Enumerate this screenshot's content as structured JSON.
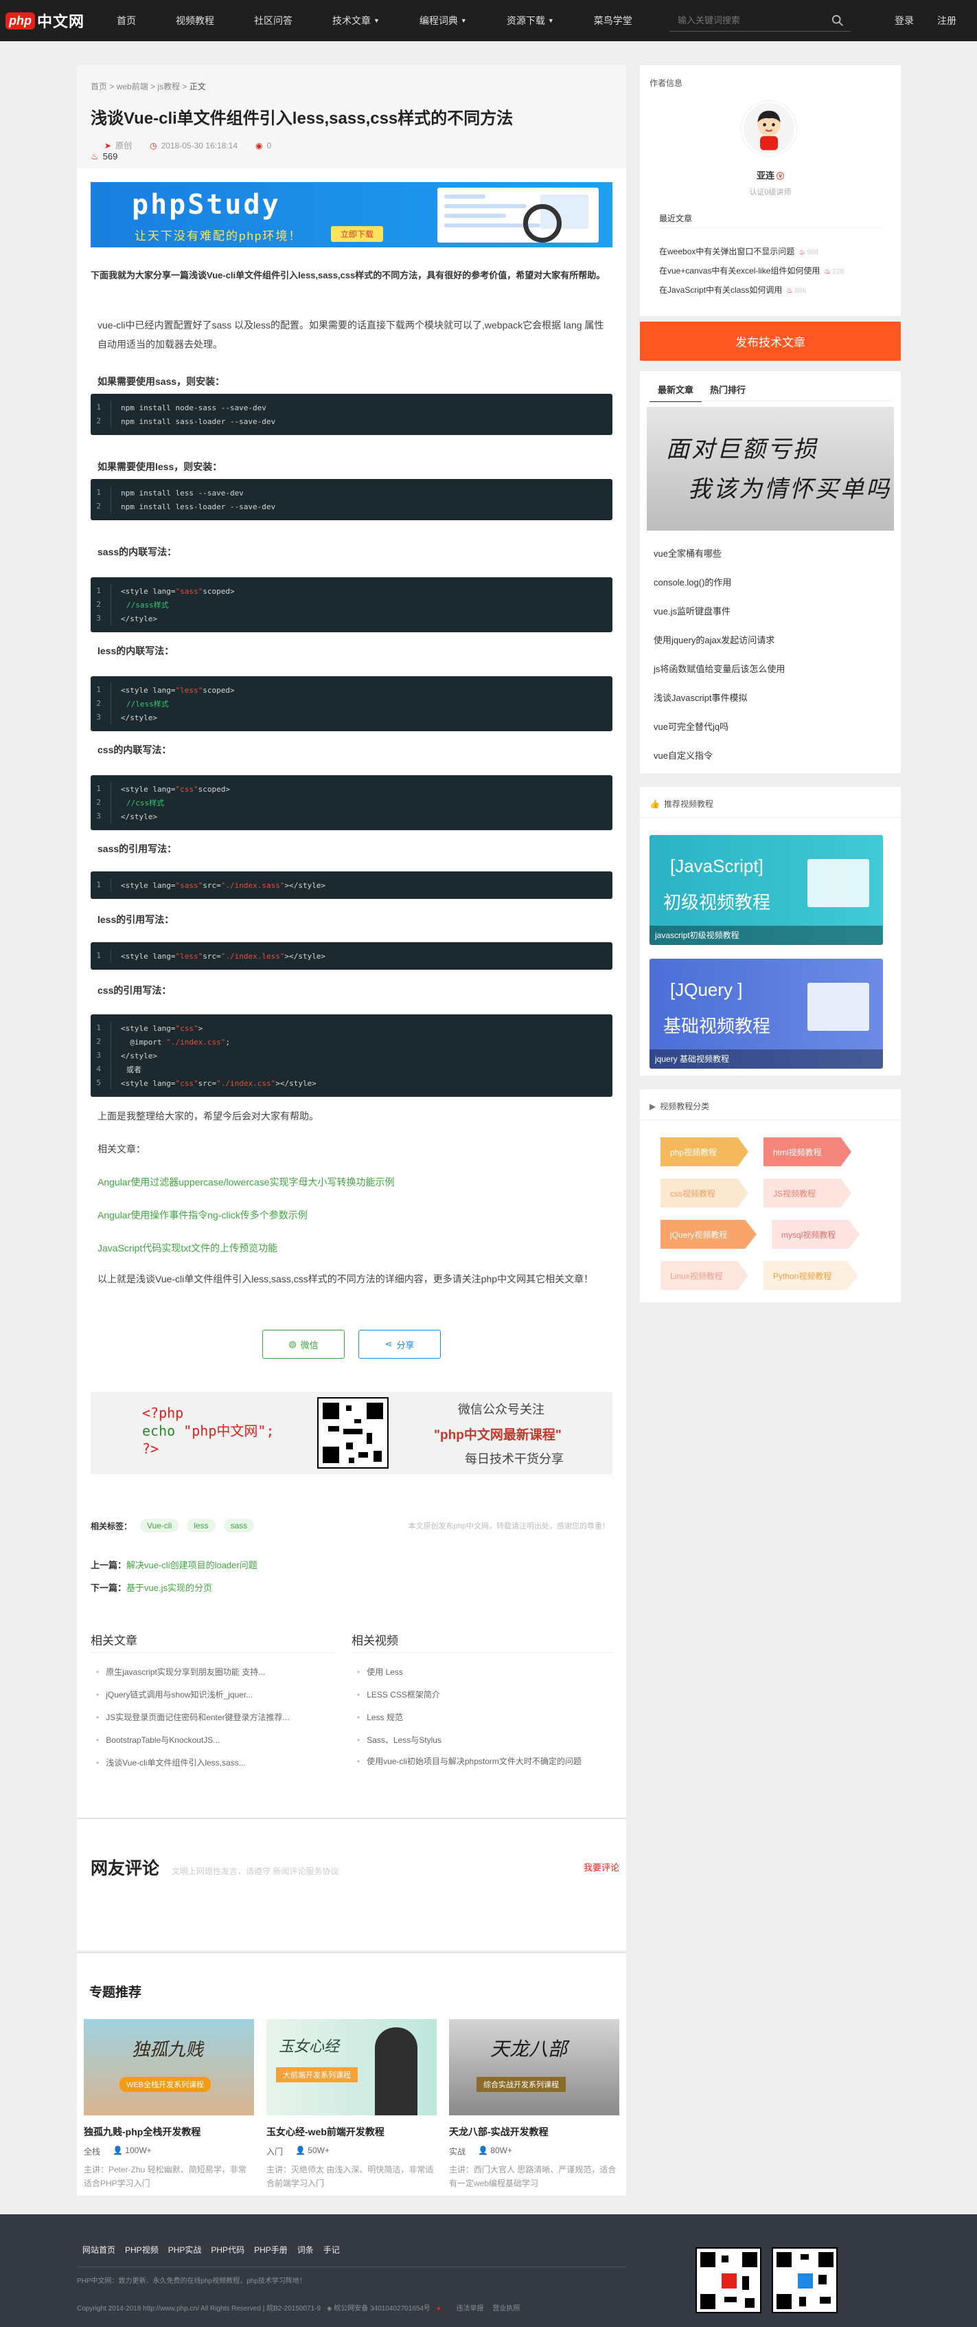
{
  "nav": {
    "logo_php": "php",
    "logo_cn": "中文网",
    "items": [
      "首页",
      "视频教程",
      "社区问答",
      "技术文章",
      "编程词典",
      "资源下载",
      "菜鸟学堂"
    ],
    "search_placeholder": "输入关键词搜索",
    "login": "登录",
    "register": "注册"
  },
  "article": {
    "breadcrumb": [
      "首页",
      "web前端",
      "js教程",
      "正文"
    ],
    "title": "浅谈Vue-cli单文件组件引入less,sass,css样式的不同方法",
    "author": "原创",
    "date": "2018-05-30 16:18:14",
    "views": "0",
    "favorites": "569",
    "banner_title": "phpStudy",
    "banner_slogan": "让天下没有难配的php环境！",
    "banner_button": "立即下载",
    "intro": "下面我就为大家分享一篇浅谈Vue-cli单文件组件引入less,sass,css样式的不同方法，具有很好的参考价值，希望对大家有所帮助。",
    "p1": "vue-cli中已经内置配置好了sass 以及less的配置。如果需要的话直接下载两个模块就可以了,webpack它会根据 lang 属性自动用适当的加载器去处理。",
    "h_sass": "如果需要使用sass，则安装：",
    "code_sass": [
      "npm install node-sass --save-dev",
      "npm install sass-loader --save-dev"
    ],
    "h_less": "如果需要使用less，则安装：",
    "code_less": [
      "npm install less --save-dev",
      "npm install less-loader --save-dev"
    ],
    "h_sass_inline": "sass的内联写法：",
    "code_sass_inline": {
      "l1a": "<style lang=",
      "l1s": "\"sass\"",
      "l1b": " scoped>",
      "l2": "//sass样式",
      "l3": "</style>"
    },
    "h_less_inline": "less的内联写法：",
    "code_less_inline": {
      "l1a": "<style lang=",
      "l1s": "\"less\"",
      "l1b": " scoped>",
      "l2": "//less样式",
      "l3": "</style>"
    },
    "h_css_inline": "css的内联写法：",
    "code_css_inline": {
      "l1a": "<style lang=",
      "l1s": "\"css\"",
      "l1b": " scoped>",
      "l2": "//css样式",
      "l3": "</style>"
    },
    "h_sass_ref": "sass的引用写法：",
    "code_sass_ref": {
      "a": "<style lang=",
      "s1": "\"sass\"",
      "b": " src=",
      "s2": "\"./index.sass\"",
      "c": "></style>"
    },
    "h_less_ref": "less的引用写法：",
    "code_less_ref": {
      "a": "<style lang=",
      "s1": "\"less\"",
      "b": " src=",
      "s2": "\"./index.less\"",
      "c": "></style>"
    },
    "h_css_ref": "css的引用写法：",
    "code_css_ref": {
      "l1a": "<style lang=",
      "l1s": "\"css\"",
      "l1b": ">",
      "l2a": "  @import ",
      "l2s": "\"./index.css\"",
      "l2b": ";",
      "l3": "</style>",
      "l4": "或者",
      "l5a": "<style lang=",
      "l5s1": "\"css\"",
      "l5b": " src=",
      "l5s2": "\"./index.css\"",
      "l5c": "></style>"
    },
    "closing": "上面是我整理给大家的，希望今后会对大家有帮助。",
    "related_label": "相关文章：",
    "links": [
      "Angular使用过滤器uppercase/lowercase实现字母大小写转换功能示例",
      "Angular使用操作事件指令ng-click传多个参数示例",
      "JavaScript代码实现txt文件的上传预览功能"
    ],
    "summary": "以上就是浅谈Vue-cli单文件组件引入less,sass,css样式的不同方法的详细内容，更多请关注php中文网其它相关文章！",
    "share_wechat": "微信",
    "share_share": "分享",
    "qr_code_line1": "<?php",
    "qr_code_line2a": "echo ",
    "qr_code_line2b": "\"php中文网\";",
    "qr_code_line3": "?>",
    "qr_text1": "微信公众号关注",
    "qr_text2": "\"php中文网最新课程\"",
    "qr_text3": "每日技术干货分享",
    "tags_label": "相关标签：",
    "tags": [
      "Vue-cli",
      "less",
      "sass"
    ],
    "copyright": "本文原创发布php中文网，转载请注明出处，感谢您的尊重！",
    "prev_label": "上一篇：",
    "prev": "解决vue-cli创建项目的loader问题",
    "next_label": "下一篇：",
    "next": "基于vue.js实现的分页",
    "related_articles_title": "相关文章",
    "related_articles": [
      "原生javascript实现分享到朋友圈功能 支持...",
      "jQuery链式调用与show知识浅析_jquer...",
      "JS实现登录页面记住密码和enter键登录方法推荐...",
      "BootstrapTable与KnockoutJS...",
      "浅谈Vue-cli单文件组件引入less,sass..."
    ],
    "related_videos_title": "相关视频",
    "related_videos": [
      "使用 Less",
      "LESS CSS框架简介",
      "Less 规范",
      "Sass、Less与Stylus",
      "使用vue-cli初始项目与解决phpstorm文件大时不确定的问题"
    ],
    "comments_title": "网友评论",
    "comments_sub": "文明上网理性发言，请遵守 新闻评论服务协议",
    "comments_write": "我要评论"
  },
  "topics": {
    "title": "专题推荐",
    "cards": [
      {
        "name": "独孤九贱-php全栈开发教程",
        "level": "全栈",
        "count": "100W+",
        "desc": "主讲：Peter-Zhu 轻松幽默、简短易学，非常适合PHP学习入门",
        "img_title": "独孤九贱",
        "img_sub": "WEB全栈开发系列课程"
      },
      {
        "name": "玉女心经-web前端开发教程",
        "level": "入门",
        "count": "50W+",
        "desc": "主讲：灭绝师太 由浅入深、明快简洁，非常适合前端学习入门",
        "img_title": "玉女心经",
        "img_sub": "大前端开发系列课程"
      },
      {
        "name": "天龙八部-实战开发教程",
        "level": "实战",
        "count": "80W+",
        "desc": "主讲：西门大官人 思路清晰、严谨规范，适合有一定web编程基础学习",
        "img_title": "天龙八部",
        "img_sub": "综合实战开发系列课程"
      }
    ]
  },
  "footer": {
    "links": [
      "网站首页",
      "PHP视频",
      "PHP实战",
      "PHP代码",
      "PHP手册",
      "词条",
      "手记"
    ],
    "note": "PHP中文网：致力更新、永久免费的在线php视频教程，php技术学习阵地！",
    "copyright": "Copyright 2014-2018 http://www.php.cn/ All Rights Reserved | 皖B2-20150071-9",
    "police": "皖公网安备 34010402701654号",
    "report": "违法举报",
    "partner": "营业执照"
  },
  "sidebar": {
    "author_label": "作者信息",
    "author_name": "亚连",
    "author_role": "认证0级讲师",
    "recent_label": "最近文章",
    "recent": [
      {
        "t": "在weebox中有关弹出窗口不显示问题",
        "c": "988"
      },
      {
        "t": "在vue+canvas中有关excel-like组件如何使用",
        "c": "228"
      },
      {
        "t": "在JavaScript中有关class如何调用",
        "c": "886"
      }
    ],
    "publish": "发布技术文章",
    "tab_new": "最新文章",
    "tab_hot": "热门排行",
    "banner_line1": "面对巨额亏损",
    "banner_line2": "我该为情怀买单吗",
    "articles": [
      "vue全家桶有哪些",
      "console.log()的作用",
      "vue.js监听键盘事件",
      "使用jquery的ajax发起访问请求",
      "js将函数赋值给变量后该怎么使用",
      "浅谈Javascript事件模拟",
      "vue可完全替代jq吗",
      "vue自定义指令"
    ],
    "videos_label": "推荐视频教程",
    "videos": [
      {
        "en": "[JavaScript]",
        "zh": "初级视频教程",
        "bar": "javascript初级视频教程"
      },
      {
        "en": "[JQuery ]",
        "zh": "基础视频教程",
        "bar": "jquery 基础视频教程"
      }
    ],
    "cats_label": "视频教程分类",
    "cats": [
      "php视频教程",
      "html视频教程",
      "css视频教程",
      "JS视频教程",
      "jQuery视频教程",
      "mysql视频教程",
      "Linux视频教程",
      "Python视频教程"
    ]
  },
  "colors": {
    "accent": "#e8201a",
    "link": "#3fa83f",
    "publish": "#ff5722",
    "nav_bg": "#1f1f1f",
    "footer_bg": "#353a42"
  }
}
